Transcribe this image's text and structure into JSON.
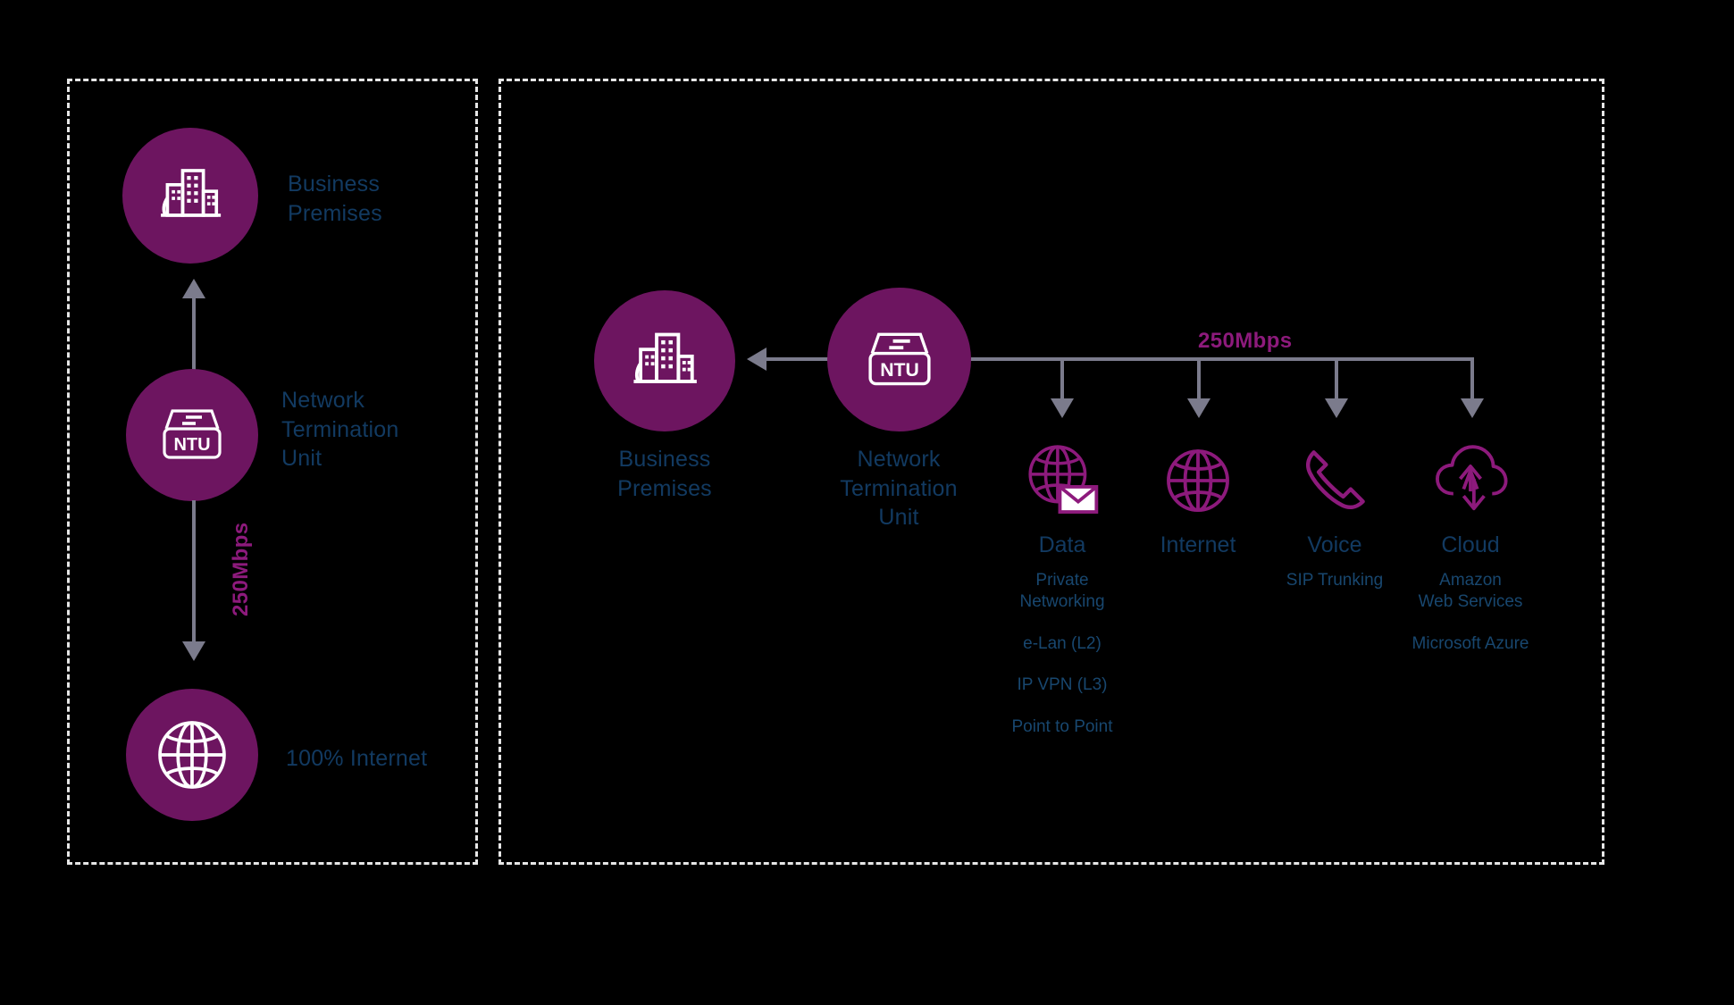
{
  "diagram": {
    "background_color": "#000000",
    "accent_purple": "#6d1560",
    "accent_magenta": "#8d1a7c",
    "label_navy": "#123a61",
    "arrow_gray": "#7b7b8c",
    "border_color": "#e6e6e6"
  },
  "left_panel": {
    "nodes": [
      {
        "id": "business-premises",
        "icon": "office-buildings-icon",
        "label": "Business\nPremises",
        "label_line1": "Business",
        "label_line2": "Premises"
      },
      {
        "id": "ntu",
        "icon": "ntu-box-icon",
        "icon_text": "NTU",
        "label_line1": "Network",
        "label_line2": "Termination",
        "label_line3": "Unit"
      },
      {
        "id": "internet",
        "icon": "globe-icon",
        "label_line1": "100% Internet"
      }
    ],
    "speed_label": "250Mbps"
  },
  "right_panel": {
    "nodes": [
      {
        "id": "business-premises",
        "icon": "office-buildings-icon",
        "label_line1": "Business",
        "label_line2": "Premises"
      },
      {
        "id": "ntu",
        "icon": "ntu-box-icon",
        "icon_text": "NTU",
        "label_line1": "Network",
        "label_line2": "Termination",
        "label_line3": "Unit"
      }
    ],
    "speed_label": "250Mbps",
    "services": [
      {
        "id": "data",
        "icon": "globe-mail-icon",
        "title": "Data",
        "sub_lines": [
          "Private",
          "Networking"
        ],
        "items": [
          "e-Lan (L2)",
          "IP VPN (L3)",
          "Point to Point"
        ]
      },
      {
        "id": "internet",
        "icon": "globe-icon",
        "title": "Internet",
        "sub_lines": [],
        "items": []
      },
      {
        "id": "voice",
        "icon": "telephone-handset-icon",
        "title": "Voice",
        "sub_lines": [
          "SIP Trunking"
        ],
        "items": []
      },
      {
        "id": "cloud",
        "icon": "cloud-updown-arrows-icon",
        "title": "Cloud",
        "sub_lines": [
          "Amazon",
          "Web Services"
        ],
        "items": [
          "Microsoft Azure"
        ]
      }
    ]
  }
}
